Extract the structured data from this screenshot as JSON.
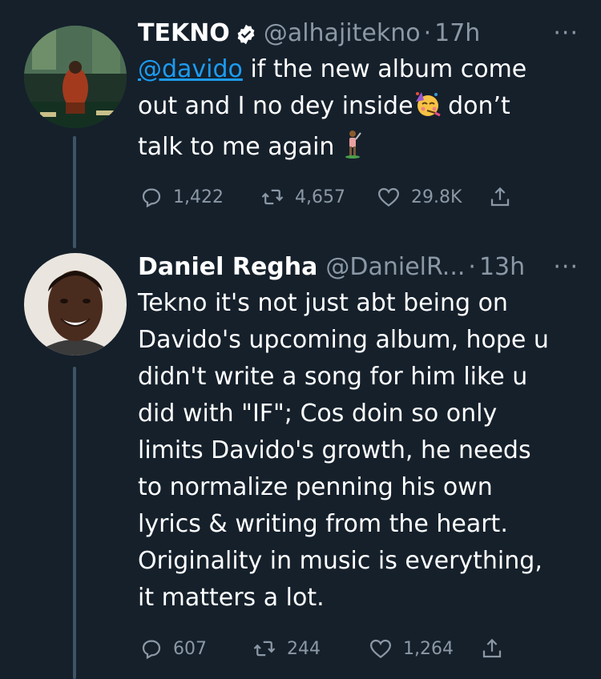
{
  "tweets": [
    {
      "name": "TEKNO",
      "handle": "@alhajitekno",
      "dot": "·",
      "time": "17h",
      "verified": true,
      "more": "···",
      "mention": "@davido",
      "text_line1": " if the new album come",
      "text_line2_a": "out and I no dey inside",
      "text_line2_b": " don’t",
      "text_line3": "talk to me again ",
      "emojis": [
        "partying-face-icon",
        "person-golfing-icon"
      ],
      "replies": "1,422",
      "retweets": "4,657",
      "likes": "29.8K"
    },
    {
      "name": "Daniel Regha",
      "handle": "@DanielR...",
      "dot": "·",
      "time": "13h",
      "verified": false,
      "more": "···",
      "lines": [
        "Tekno it's not just abt being on",
        "Davido's upcoming album, hope u",
        "didn't write a song for him like u",
        "did with \"IF\"; Cos doin so only",
        "limits Davido's growth, he needs",
        "to normalize penning his own",
        "lyrics & writing from the heart.",
        "Originality in music is everything,",
        "it matters a lot."
      ],
      "replies": "607",
      "retweets": "244",
      "likes": "1,264"
    }
  ],
  "colors": {
    "background": "#15202b",
    "text": "#ffffff",
    "secondary": "#8b98a5",
    "link": "#1d9bf0",
    "thread_line": "#3d5466"
  }
}
